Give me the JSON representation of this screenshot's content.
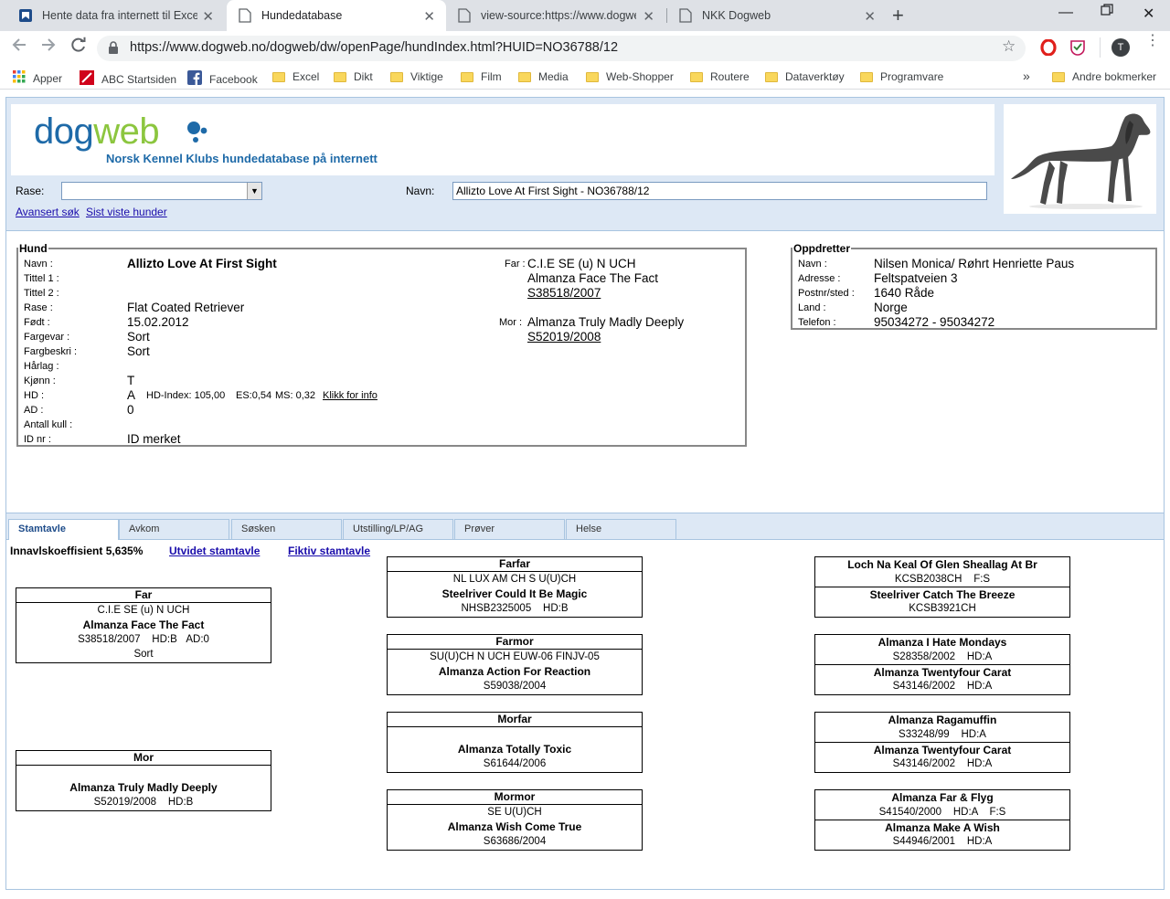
{
  "browser": {
    "tabs": [
      {
        "title": "Hente data fra internett til Excel o",
        "close": "✕"
      },
      {
        "title": "Hundedatabase",
        "close": "✕"
      },
      {
        "title": "view-source:https://www.dogweb.",
        "close": "✕"
      },
      {
        "title": "NKK Dogweb",
        "close": "✕"
      }
    ],
    "new_tab": "+",
    "url": "https://www.dogweb.no/dogweb/dw/openPage/hundIndex.html?HUID=NO36788/12",
    "profile_initial": "T",
    "bookmarks": [
      "Apper",
      "ABC Startsiden",
      "Facebook",
      "Excel",
      "Dikt",
      "Viktige",
      "Film",
      "Media",
      "Web-Shopper",
      "Routere",
      "Dataverktøy",
      "Programvare"
    ],
    "more_bookmarks": "»",
    "other_bookmarks": "Andre bokmerker"
  },
  "header": {
    "logo_dog": "dog",
    "logo_web": "web",
    "tagline": "Norsk Kennel Klubs hundedatabase på internett",
    "rase_label": "Rase:",
    "navn_label": "Navn:",
    "navn_value": "Allizto Love At First Sight - NO36788/12",
    "advanced_search": "Avansert søk",
    "recent_dogs": "Sist viste hunder"
  },
  "hund": {
    "legend": "Hund",
    "fields": [
      {
        "k": "Navn :",
        "v": "Allizto Love At First Sight"
      },
      {
        "k": "Tittel 1 :",
        "v": ""
      },
      {
        "k": "Tittel 2 :",
        "v": ""
      },
      {
        "k": "Rase :",
        "v": "Flat Coated Retriever"
      },
      {
        "k": "Født :",
        "v": "15.02.2012"
      },
      {
        "k": "Fargevar :",
        "v": "Sort"
      },
      {
        "k": "Fargbeskri :",
        "v": "Sort"
      },
      {
        "k": "Hårlag :",
        "v": ""
      },
      {
        "k": "Kjønn :",
        "v": "T"
      },
      {
        "k": "HD :",
        "v": "A"
      },
      {
        "k": "AD :",
        "v": "0"
      },
      {
        "k": "Antall kull :",
        "v": ""
      },
      {
        "k": "ID nr :",
        "v": "ID merket"
      }
    ],
    "hd_index": "HD-Index: 105,00",
    "hd_es": "ES:0,54",
    "hd_ms": "MS: 0,32",
    "hd_link": "Klikk for info",
    "far_label": "Far :",
    "far_title": "C.I.E SE (u) N UCH",
    "far_name": "Almanza Face The Fact",
    "far_reg": "S38518/2007",
    "mor_label": "Mor :",
    "mor_name": "Almanza Truly Madly Deeply",
    "mor_reg": "S52019/2008"
  },
  "oppdretter": {
    "legend": "Oppdretter",
    "fields": [
      {
        "k": "Navn :",
        "v": "Nilsen Monica/ Røhrt Henriette Paus"
      },
      {
        "k": "Adresse :",
        "v": "Feltspatveien 3"
      },
      {
        "k": "Postnr/sted :",
        "v": "1640 Råde"
      },
      {
        "k": "Land :",
        "v": "Norge"
      },
      {
        "k": "Telefon :",
        "v": "95034272 - 95034272"
      }
    ]
  },
  "page_tabs": [
    "Stamtavle",
    "Avkom",
    "Søsken",
    "Utstilling/LP/AG",
    "Prøver",
    "Helse"
  ],
  "stamtavle": {
    "inbreeding": "Innavlskoeffisient 5,635%",
    "extended_link": "Utvidet stamtavle",
    "fictive_link": "Fiktiv stamtavle",
    "far": {
      "header": "Far",
      "title": "C.I.E SE (u) N UCH",
      "name": "Almanza Face The Fact",
      "reg": "S38518/2007",
      "hd": "HD:B",
      "ad": "AD:0",
      "color": "Sort"
    },
    "mor": {
      "header": "Mor",
      "name": "Almanza Truly Madly Deeply",
      "reg": "S52019/2008",
      "hd": "HD:B"
    },
    "farfar": {
      "header": "Farfar",
      "title": "NL LUX AM CH S U(U)CH",
      "name": "Steelriver Could It Be Magic",
      "reg": "NHSB2325005",
      "hd": "HD:B"
    },
    "farmor": {
      "header": "Farmor",
      "title": "SU(U)CH N UCH EUW-06 FINJV-05",
      "name": "Almanza Action For Reaction",
      "reg": "S59038/2004"
    },
    "morfar": {
      "header": "Morfar",
      "name": "Almanza Totally Toxic",
      "reg": "S61644/2006"
    },
    "mormor": {
      "header": "Mormor",
      "title": "SE U(U)CH",
      "name": "Almanza Wish Come True",
      "reg": "S63686/2004"
    },
    "gen3": [
      {
        "top_name": "Loch Na Keal Of Glen Sheallag At Br",
        "top_reg": "KCSB2038CH",
        "top_extra": "F:S",
        "bot_name": "Steelriver Catch The Breeze",
        "bot_reg": "KCSB3921CH",
        "bot_extra": ""
      },
      {
        "top_name": "Almanza I Hate Mondays",
        "top_reg": "S28358/2002",
        "top_extra": "HD:A",
        "bot_name": "Almanza Twentyfour Carat",
        "bot_reg": "S43146/2002",
        "bot_extra": "HD:A"
      },
      {
        "top_name": "Almanza Ragamuffin",
        "top_reg": "S33248/99",
        "top_extra": "HD:A",
        "bot_name": "Almanza Twentyfour Carat",
        "bot_reg": "S43146/2002",
        "bot_extra": "HD:A"
      },
      {
        "top_name": "Almanza Far & Flyg",
        "top_reg": "S41540/2000",
        "top_extra": "HD:A    F:S",
        "bot_name": "Almanza Make A Wish",
        "bot_reg": "S44946/2001",
        "bot_extra": "HD:A"
      }
    ]
  }
}
